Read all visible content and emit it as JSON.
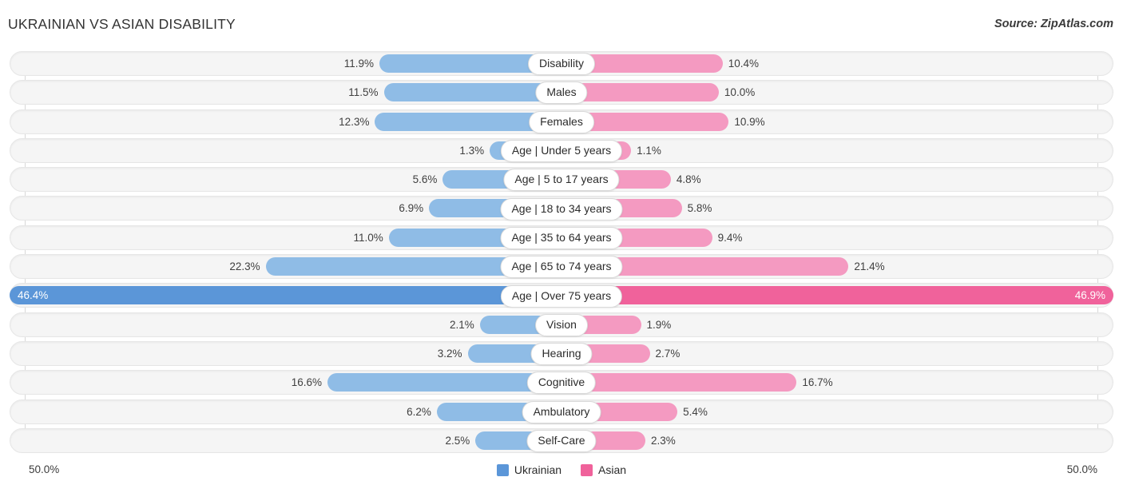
{
  "header": {
    "title": "UKRAINIAN VS ASIAN DISABILITY",
    "source": "Source: ZipAtlas.com"
  },
  "legend": {
    "items": [
      {
        "label": "Ukrainian",
        "color": "#5B96D8"
      },
      {
        "label": "Asian",
        "color": "#F0629B"
      }
    ]
  },
  "axis": {
    "left_label": "50.0%",
    "right_label": "50.0%"
  },
  "colors": {
    "blue": "#8FBCE6",
    "pink": "#F49AC1",
    "blue_highlight": "#5B96D8",
    "pink_highlight": "#F0629B",
    "track": "#f5f5f5",
    "gridline": "#d8d8d8"
  },
  "chart_data": {
    "type": "bar",
    "title": "UKRAINIAN VS ASIAN DISABILITY",
    "subtitle": "Source: ZipAtlas.com",
    "orientation": "horizontal-diverging",
    "xlabel": "",
    "ylabel": "",
    "xlim": [
      50.0,
      50.0
    ],
    "axis_left_max": 50.0,
    "axis_right_max": 50.0,
    "grid": true,
    "legend_position": "bottom-center",
    "categories": [
      "Disability",
      "Males",
      "Females",
      "Age | Under 5 years",
      "Age | 5 to 17 years",
      "Age | 18 to 34 years",
      "Age | 35 to 64 years",
      "Age | 65 to 74 years",
      "Age | Over 75 years",
      "Vision",
      "Hearing",
      "Cognitive",
      "Ambulatory",
      "Self-Care"
    ],
    "series": [
      {
        "name": "Ukrainian",
        "color": "#8FBCE6",
        "values": [
          11.9,
          11.5,
          12.3,
          1.3,
          5.6,
          6.9,
          11.0,
          22.3,
          46.4,
          2.1,
          3.2,
          16.6,
          6.2,
          2.5
        ],
        "labels": [
          "11.9%",
          "11.5%",
          "12.3%",
          "1.3%",
          "5.6%",
          "6.9%",
          "11.0%",
          "22.3%",
          "46.4%",
          "2.1%",
          "3.2%",
          "16.6%",
          "6.2%",
          "2.5%"
        ]
      },
      {
        "name": "Asian",
        "color": "#F49AC1",
        "values": [
          10.4,
          10.0,
          10.9,
          1.1,
          4.8,
          5.8,
          9.4,
          21.4,
          46.9,
          1.9,
          2.7,
          16.7,
          5.4,
          2.3
        ],
        "labels": [
          "10.4%",
          "10.0%",
          "10.9%",
          "1.1%",
          "4.8%",
          "5.8%",
          "9.4%",
          "21.4%",
          "46.9%",
          "1.9%",
          "2.7%",
          "16.7%",
          "5.4%",
          "2.3%"
        ]
      }
    ],
    "highlighted_rows": [
      "Age | Over 75 years"
    ]
  },
  "rows": [
    {
      "label": "Disability",
      "left": "11.9%",
      "right": "10.4%",
      "lw": 33.0,
      "rw": 29.2,
      "hi": false
    },
    {
      "label": "Males",
      "left": "11.5%",
      "right": "10.0%",
      "lw": 32.2,
      "rw": 28.5,
      "hi": false
    },
    {
      "label": "Females",
      "left": "12.3%",
      "right": "10.9%",
      "lw": 33.8,
      "rw": 30.3,
      "hi": false
    },
    {
      "label": "Age | Under 5 years",
      "left": "1.3%",
      "right": "1.1%",
      "lw": 13.0,
      "rw": 12.6,
      "hi": false
    },
    {
      "label": "Age | 5 to 17 years",
      "left": "5.6%",
      "right": "4.8%",
      "lw": 21.5,
      "rw": 19.8,
      "hi": false
    },
    {
      "label": "Age | 18 to 34 years",
      "left": "6.9%",
      "right": "5.8%",
      "lw": 24.0,
      "rw": 21.8,
      "hi": false
    },
    {
      "label": "Age | 35 to 64 years",
      "left": "11.0%",
      "right": "9.4%",
      "lw": 31.3,
      "rw": 27.3,
      "hi": false
    },
    {
      "label": "Age | 65 to 74 years",
      "left": "22.3%",
      "right": "21.4%",
      "lw": 53.6,
      "rw": 52.0,
      "hi": false
    },
    {
      "label": "Age | Over 75 years",
      "left": "46.4%",
      "right": "46.9%",
      "lw": 100.0,
      "rw": 100.0,
      "hi": true
    },
    {
      "label": "Vision",
      "left": "2.1%",
      "right": "1.9%",
      "lw": 14.8,
      "rw": 14.4,
      "hi": false
    },
    {
      "label": "Hearing",
      "left": "3.2%",
      "right": "2.7%",
      "lw": 17.0,
      "rw": 16.0,
      "hi": false
    },
    {
      "label": "Cognitive",
      "left": "16.6%",
      "right": "16.7%",
      "lw": 42.4,
      "rw": 42.6,
      "hi": false
    },
    {
      "label": "Ambulatory",
      "left": "6.2%",
      "right": "5.4%",
      "lw": 22.6,
      "rw": 21.0,
      "hi": false
    },
    {
      "label": "Self-Care",
      "left": "2.5%",
      "right": "2.3%",
      "lw": 15.6,
      "rw": 15.2,
      "hi": false
    }
  ]
}
